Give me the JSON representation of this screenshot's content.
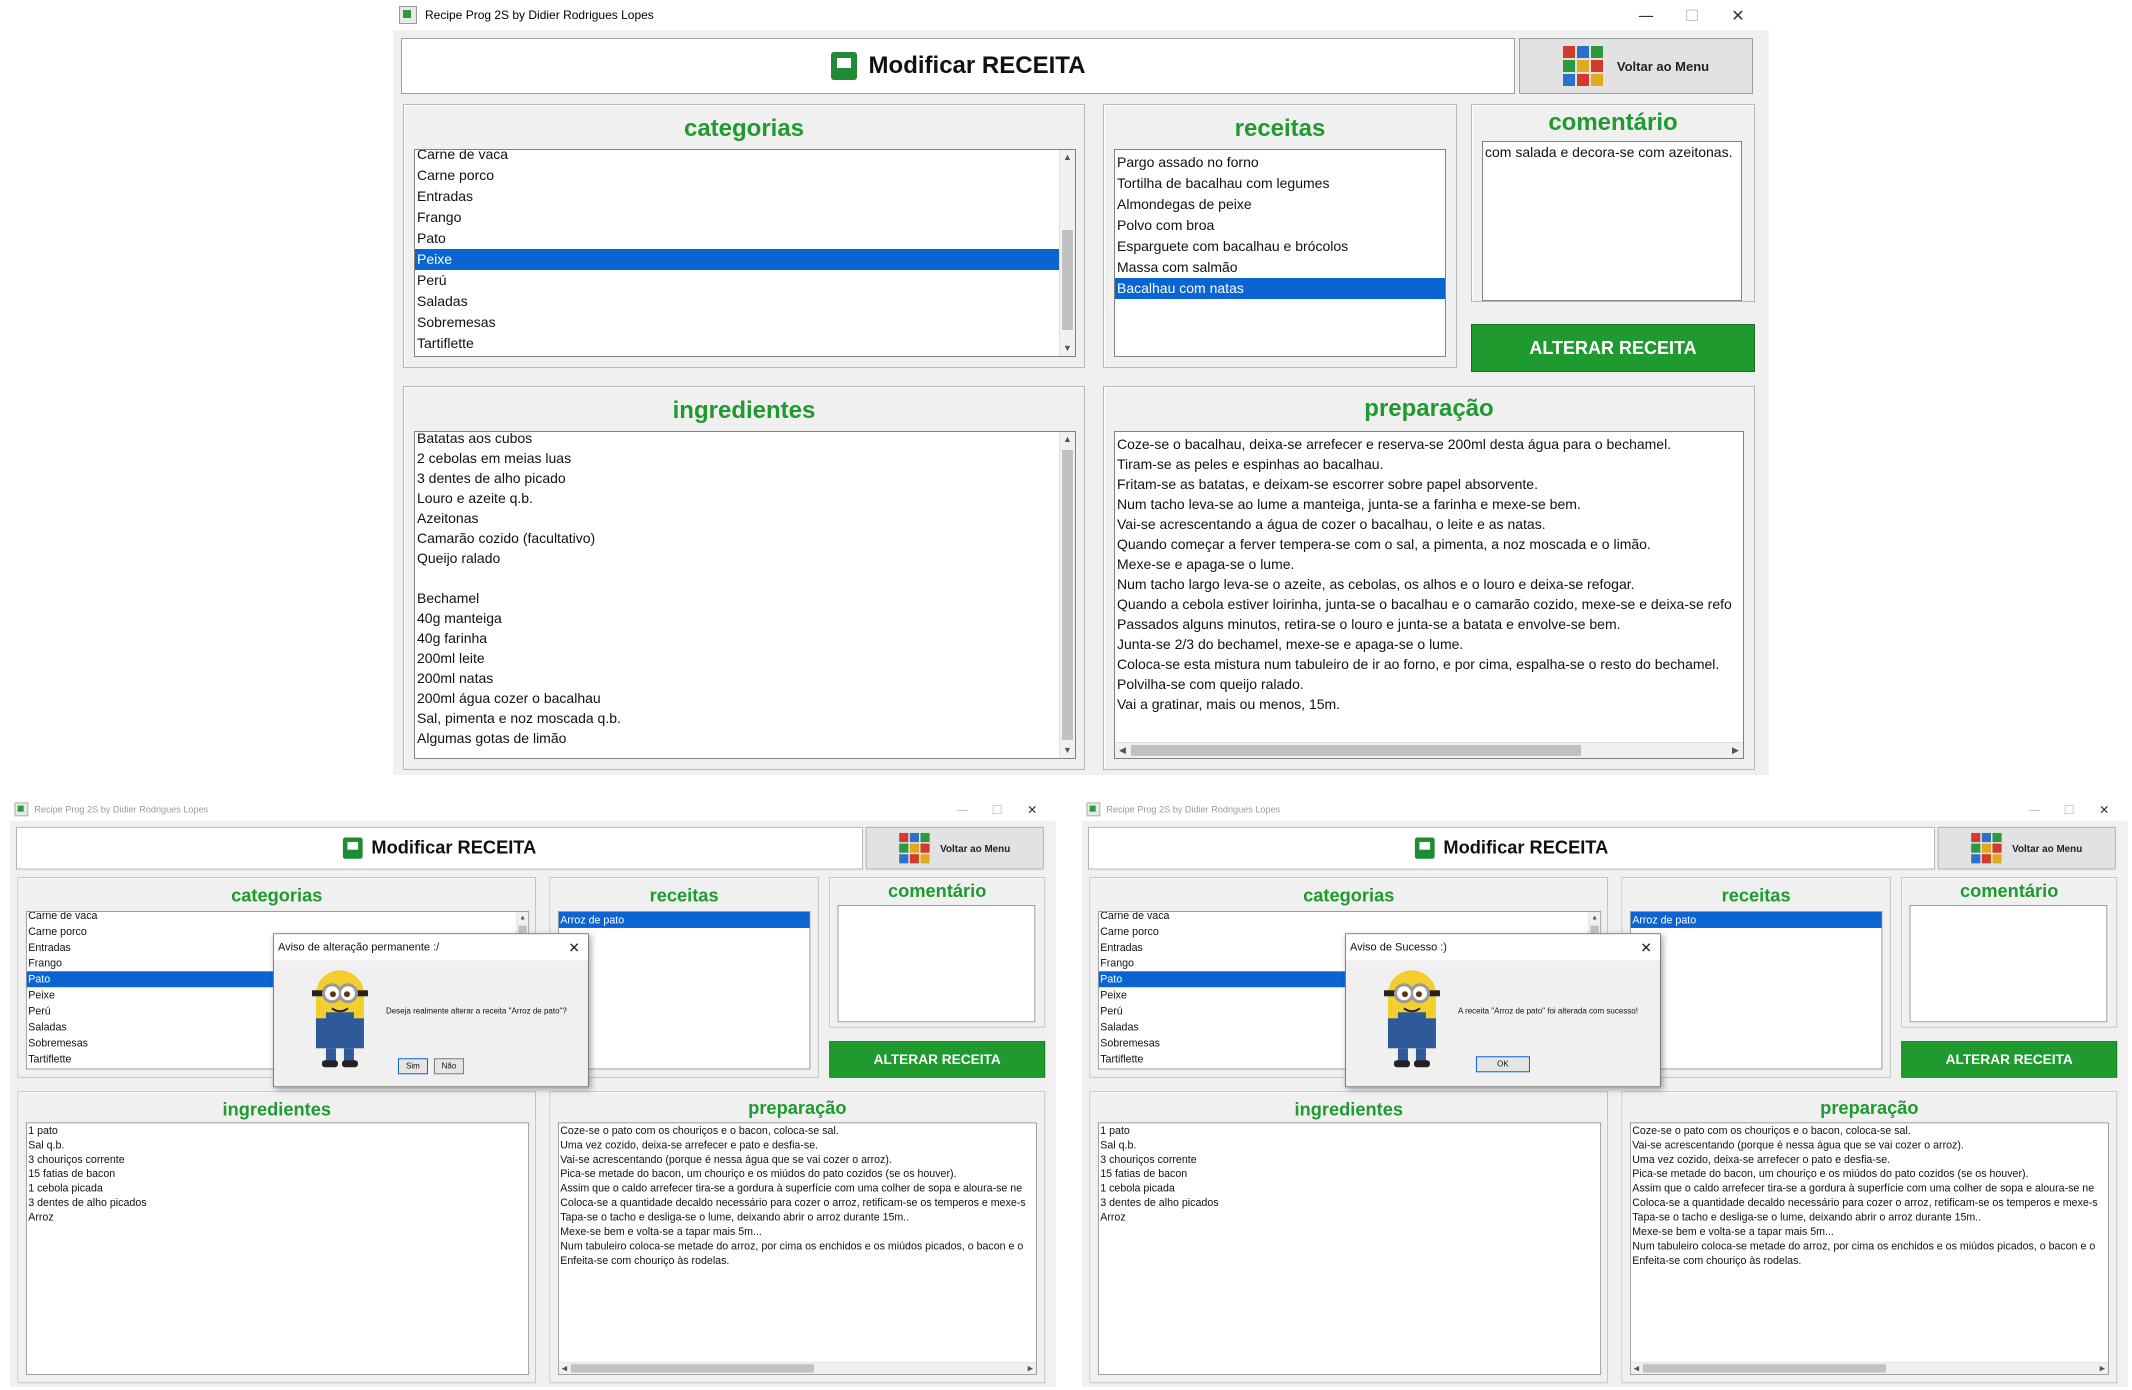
{
  "window": {
    "title": "Recipe Prog 2S by Didier Rodrigues Lopes",
    "ctrl_min": "—",
    "ctrl_max": "☐",
    "ctrl_close": "✕"
  },
  "header": {
    "title": "Modificar RECEITA",
    "menu_button": "Voltar ao Menu"
  },
  "sections": {
    "categorias": "categorias",
    "receitas": "receitas",
    "comentario": "comentário",
    "ingredientes": "ingredientes",
    "preparacao": "preparação",
    "alter_button": "ALTERAR RECEITA"
  },
  "colors": {
    "accent_green": "#1f9a2e",
    "selection_blue": "#0a64d2"
  },
  "main": {
    "categorias": [
      "Carne de vaca",
      "Carne porco",
      "Entradas",
      "Frango",
      "Pato",
      "Peixe",
      "Perú",
      "Saladas",
      "Sobremesas",
      "Tartiflette"
    ],
    "categorias_selected": 5,
    "receitas": [
      "Pargo assado no forno",
      "Tortilha de bacalhau com legumes",
      "Almondegas de peixe",
      "Polvo com broa",
      "Esparguete com bacalhau e brócolos",
      "Massa com salmão",
      "Bacalhau com natas"
    ],
    "receitas_selected": 6,
    "comentario": "com salada e decora-se com azeitonas.",
    "ingredientes": [
      "Batatas aos cubos",
      "2 cebolas em meias luas",
      "3 dentes de alho picado",
      "Louro e azeite q.b.",
      "Azeitonas",
      "Camarão cozido (facultativo)",
      "Queijo ralado",
      "",
      "Bechamel",
      "40g manteiga",
      "40g farinha",
      "200ml leite",
      "200ml natas",
      "200ml água cozer o bacalhau",
      "Sal, pimenta e noz moscada q.b.",
      "Algumas gotas de limão"
    ],
    "preparacao": [
      "Coze-se o bacalhau, deixa-se arrefecer e reserva-se 200ml desta água para o bechamel.",
      "Tiram-se as peles e espinhas ao bacalhau.",
      "Fritam-se as batatas, e deixam-se escorrer sobre papel absorvente.",
      "Num tacho leva-se ao lume a manteiga, junta-se a farinha e mexe-se bem.",
      "Vai-se acrescentando a água de cozer o bacalhau, o leite e as natas.",
      "Quando começar a ferver tempera-se com o sal, a pimenta, a noz moscada e o limão.",
      "Mexe-se e apaga-se o lume.",
      "Num tacho largo leva-se o azeite, as cebolas, os alhos e o louro e deixa-se refogar.",
      "Quando a cebola estiver loirinha, junta-se o bacalhau e o camarão cozido, mexe-se e deixa-se refo",
      "Passados alguns minutos, retira-se o louro e junta-se a batata e envolve-se bem.",
      "Junta-se 2/3 do bechamel, mexe-se e apaga-se o lume.",
      "Coloca-se esta mistura  num tabuleiro de ir ao forno, e por cima, espalha-se o resto do bechamel.",
      "Polvilha-se com queijo ralado.",
      "Vai a gratinar, mais ou menos, 15m."
    ]
  },
  "secondary": {
    "categorias_selected": 4,
    "receitas": [
      "Arroz de pato"
    ],
    "receitas_selected": 0,
    "comentario": "",
    "ingredientes": [
      "1 pato",
      "Sal q.b.",
      "3 chouriços corrente",
      "15 fatias de bacon",
      "1 cebola picada",
      "3 dentes de alho picados",
      "Arroz"
    ],
    "preparacao_left": [
      "Coze-se o pato com os chouriços e o bacon, coloca-se sal.",
      "Uma vez cozido, deixa-se arrefecer e pato e desfia-se.",
      "Vai-se acrescentando (porque é nessa água que se vai cozer o arroz).",
      "Pica-se metade do bacon, um chouriço e os miúdos do pato cozidos (se os houver).",
      "Assim que o caldo arrefecer tira-se a gordura à superfície com uma colher de sopa e aloura-se ne",
      "Coloca-se a quantidade decaldo necessário para cozer o arroz, retificam-se os temperos e mexe-s",
      "Tapa-se o tacho e desliga-se o lume, deixando abrir o arroz durante 15m..",
      "Mexe-se bem e volta-se a tapar mais 5m...",
      "Num tabuleiro coloca-se metade do arroz, por cima os enchidos e os miúdos picados, o bacon e o",
      "Enfeita-se com chouriço às rodelas."
    ],
    "preparacao_right": [
      "Coze-se o pato com os chouriços e o bacon, coloca-se sal.",
      "Vai-se acrescentando (porque é nessa água que se vai cozer o arroz).",
      "Uma vez cozido, deixa-se arrefecer o pato e desfia-se.",
      "Pica-se metade do bacon, um chouriço e os miúdos do pato cozidos (se os houver).",
      "Assim que o caldo arrefecer tira-se a gordura à superfície com uma colher de sopa e aloura-se ne",
      "Coloca-se a quantidade decaldo necessário para cozer o arroz, retificam-se os temperos e mexe-s",
      "Tapa-se o tacho e desliga-se o lume, deixando abrir o arroz durante 15m..",
      "Mexe-se bem e volta-se a tapar mais 5m...",
      "Num tabuleiro coloca-se metade do arroz, por cima os enchidos e os miúdos picados, o bacon e o",
      "Enfeita-se com chouriço às rodelas."
    ]
  },
  "dialog_confirm": {
    "title": "Aviso de alteração permanente :/",
    "message": "Deseja realmente alterar a receita \"Arroz de pato\"?",
    "yes": "Sim",
    "no": "Não"
  },
  "dialog_success": {
    "title": "Aviso de Sucesso :)",
    "message": "A receita \"Arroz de pato\" foi alterada com sucesso!",
    "ok": "OK"
  }
}
